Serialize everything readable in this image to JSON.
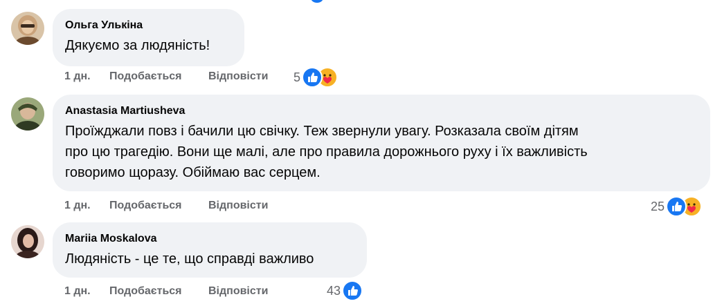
{
  "comments": [
    {
      "author": "Ольга Улькіна",
      "text": "Дякуємо за людяність!",
      "time": "1 дн.",
      "like_label": "Подобається",
      "reply_label": "Відповісти",
      "reaction_count": "5",
      "reactions": [
        "like-icon",
        "care-icon"
      ],
      "avatar_colors": [
        "#c9a27a",
        "#6b4a2e"
      ]
    },
    {
      "author": "Anastasia Martiusheva",
      "text": "Проїжджали повз і бачили цю свічку. Теж звернули увагу. Розказала своїм дітям\nпро цю трагедію. Вони ще малі, але про правила дорожнього руху і їх важливість\nговоримо щоразу. Обіймаю вас серцем.",
      "time": "1 дн.",
      "like_label": "Подобається",
      "reply_label": "Відповісти",
      "reaction_count": "25",
      "reactions": [
        "like-icon",
        "care-icon"
      ],
      "avatar_colors": [
        "#7a8a5a",
        "#3d4a2a"
      ]
    },
    {
      "author": "Mariia Moskalova",
      "text": "Людяність - це те, що справді важливо",
      "time": "1 дн.",
      "like_label": "Подобається",
      "reply_label": "Відповісти",
      "reaction_count": "43",
      "reactions": [
        "like-icon"
      ],
      "avatar_colors": [
        "#b07a6a",
        "#2a1a18"
      ]
    }
  ],
  "colors": {
    "bubble": "#f0f2f5",
    "meta_text": "#65676b",
    "like_blue": "#1877f2",
    "care_yellow": "#f7b125"
  }
}
